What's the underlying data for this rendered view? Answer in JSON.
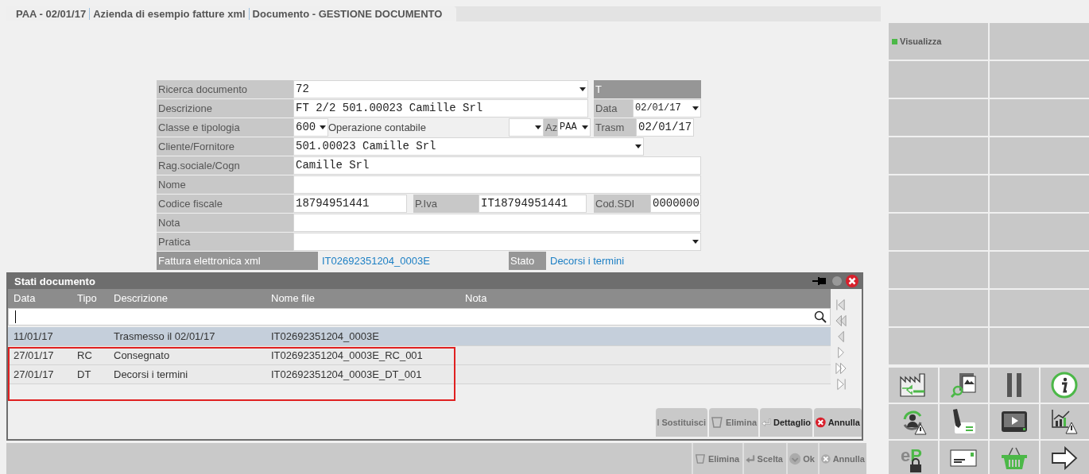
{
  "header": {
    "tabs": [
      "PAA - 02/01/17",
      "Azienda di esempio fatture xml",
      "Documento - GESTIONE DOCUMENTO"
    ]
  },
  "form": {
    "search": {
      "label": "Ricerca documento",
      "value": "72",
      "status": "T"
    },
    "description": {
      "label": "Descrizione",
      "value": "FT 2/2 501.00023 Camille Srl",
      "date_label": "Data",
      "date": "02/01/17"
    },
    "class": {
      "label": "Classe e tipologia",
      "value": "600",
      "operation_label": "Operazione contabile",
      "az_label": "Az",
      "az": "PAA",
      "trasm_label": "Trasm",
      "trasm": "02/01/17"
    },
    "customer": {
      "label": "Cliente/Fornitore",
      "value": "501.00023 Camille Srl"
    },
    "company_name": {
      "label": "Rag.sociale/Cogn",
      "value": "Camille Srl"
    },
    "name": {
      "label": "Nome"
    },
    "tax": {
      "label": "Codice fiscale",
      "value": "18794951441",
      "vat_label": "P.Iva",
      "vat": "IT18794951441",
      "sdi_label": "Cod.SDI",
      "sdi": "0000000"
    },
    "note": {
      "label": "Nota"
    },
    "practice": {
      "label": "Pratica"
    },
    "xml": {
      "label": "Fattura elettronica xml",
      "value": "IT02692351204_0003E",
      "state_label": "Stato",
      "state": "Decorsi i termini"
    }
  },
  "panel": {
    "title": "Stati documento",
    "columns": [
      "Data",
      "Tipo",
      "Descrizione",
      "Nome file",
      "Nota"
    ],
    "rows": [
      {
        "cells": [
          "11/01/17",
          "",
          "Trasmesso il 02/01/17",
          "IT02692351204_0003E",
          ""
        ],
        "selected": true,
        "highlighted": false
      },
      {
        "cells": [
          "27/01/17",
          "RC",
          "Consegnato",
          "IT02692351204_0003E_RC_001",
          ""
        ],
        "selected": false,
        "highlighted": true
      },
      {
        "cells": [
          "27/01/17",
          "DT",
          "Decorsi i termini",
          "IT02692351204_0003E_DT_001",
          ""
        ],
        "selected": false,
        "highlighted": true
      }
    ],
    "nav": [
      {
        "kind": "first",
        "disabled": true
      },
      {
        "kind": "prev-page",
        "disabled": true
      },
      {
        "kind": "prev",
        "disabled": true
      },
      {
        "kind": "next",
        "disabled": false
      },
      {
        "kind": "next-page",
        "disabled": false
      },
      {
        "kind": "last",
        "disabled": false
      }
    ],
    "buttons": [
      {
        "kind": "replace",
        "label": "Sostituisci",
        "disabled": true
      },
      {
        "kind": "delete",
        "label": "Elimina",
        "disabled": true
      },
      {
        "kind": "detail",
        "label": "Dettaglio",
        "disabled": false
      },
      {
        "kind": "cancel",
        "label": "Annulla",
        "disabled": false
      }
    ]
  },
  "bottom_bar": {
    "buttons": [
      {
        "kind": "delete",
        "label": "Elimina",
        "disabled": true
      },
      {
        "kind": "detail",
        "label": "Scelta",
        "disabled": true
      },
      {
        "kind": "ok",
        "label": "Ok",
        "disabled": true
      },
      {
        "kind": "cancel",
        "label": "Annulla",
        "disabled": true
      }
    ]
  },
  "sidebar": {
    "actions": [
      {
        "label": "Visualizza",
        "color": "#4cb848"
      }
    ],
    "tools": [
      {
        "kind": "factory"
      },
      {
        "kind": "image-search"
      },
      {
        "kind": "pause"
      },
      {
        "kind": "info"
      },
      {
        "kind": "user-warning"
      },
      {
        "kind": "pen"
      },
      {
        "kind": "video"
      },
      {
        "kind": "chart-warning"
      },
      {
        "kind": "ep-lock",
        "text": "eP"
      },
      {
        "kind": "envelope"
      },
      {
        "kind": "basket"
      },
      {
        "kind": "arrow"
      }
    ]
  }
}
